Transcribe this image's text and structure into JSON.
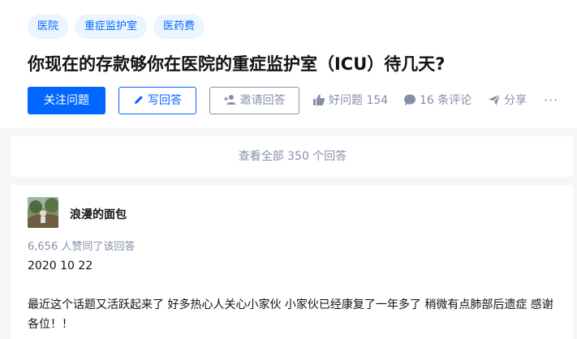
{
  "topics": [
    "医院",
    "重症监护室",
    "医药费"
  ],
  "question": {
    "title": "你现在的存款够你在医院的重症监护室（ICU）待几天?"
  },
  "actions": {
    "follow_label": "关注问题",
    "write_label": "写回答",
    "invite_label": "邀请回答",
    "like_label": "好问题 154",
    "comment_label": "16 条评论",
    "share_label": "分享",
    "more_label": "···"
  },
  "all_answers_label": "查看全部 350 个回答",
  "answer": {
    "author": "浪漫的面包",
    "upvotes": "6,656 人赞同了该回答",
    "date": "2020 10 22",
    "content": "最近这个话题又活跃起来了 好多热心人关心小家伙 小家伙已经康复了一年多了 稍微有点肺部后遗症 感谢各位！！"
  },
  "colors": {
    "accent": "#0066ff",
    "topic_bg": "#ebf5ff",
    "muted": "#8590a6",
    "page_bg": "#f6f6f6"
  }
}
